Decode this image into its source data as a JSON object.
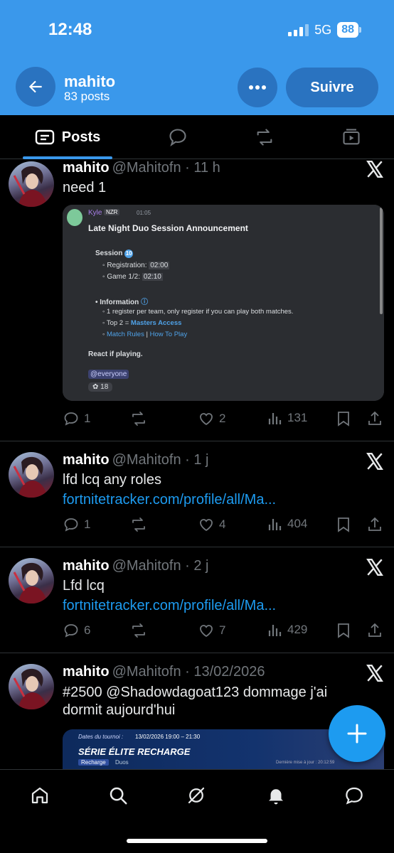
{
  "status_bar": {
    "time": "12:48",
    "network": "5G",
    "battery": "88"
  },
  "header": {
    "name": "mahito",
    "posts_count": "83 posts",
    "follow_label": "Suivre"
  },
  "tabs": [
    {
      "label": "Posts"
    }
  ],
  "posts": [
    {
      "name": "mahito",
      "handle": "@Mahitofn · 11 h",
      "text": "need 1",
      "replies": "1",
      "likes": "2",
      "views": "131",
      "embed": {
        "user": "Kyle",
        "tag": "NZR",
        "time": "01:05",
        "title": "Late Night Duo Session Announcement",
        "session_label": "Session",
        "session_num": "10",
        "reg_label": "Registration:",
        "reg_time": "02:00",
        "game_label": "Game 1/2:",
        "game_time": "02:10",
        "info_label": "Information",
        "info_line1": "1 register per team, only register if you can play both matches.",
        "top2_prefix": "Top 2 =",
        "masters": "Masters Access",
        "rules": "Match Rules",
        "sep": "|",
        "howto": "How To Play",
        "react": "React if playing.",
        "mention": "@everyone",
        "reaction_count": "18"
      }
    },
    {
      "name": "mahito",
      "handle": "@Mahitofn · 1 j",
      "text": "lfd lcq any roles",
      "link": "fortnitetracker.com/profile/all/Ma...",
      "replies": "1",
      "likes": "4",
      "views": "404"
    },
    {
      "name": "mahito",
      "handle": "@Mahitofn · 2 j",
      "text": "Lfd lcq",
      "link": "fortnitetracker.com/profile/all/Ma...",
      "replies": "6",
      "likes": "7",
      "views": "429"
    },
    {
      "name": "mahito",
      "handle": "@Mahitofn · 13/02/2026",
      "text": "#2500 @Shadowdagoat123 dommage j'ai dormit aujourd'hui",
      "embed": {
        "dates_label": "Dates du tournoi :",
        "dates": "13/02/2026 19:00 – 21:30",
        "title": "SÉRIE ÉLITE RECHARGE",
        "mode": "Recharge",
        "sub": "Duos",
        "updated": "Dernière mise à jour : 20:12:59"
      }
    }
  ]
}
